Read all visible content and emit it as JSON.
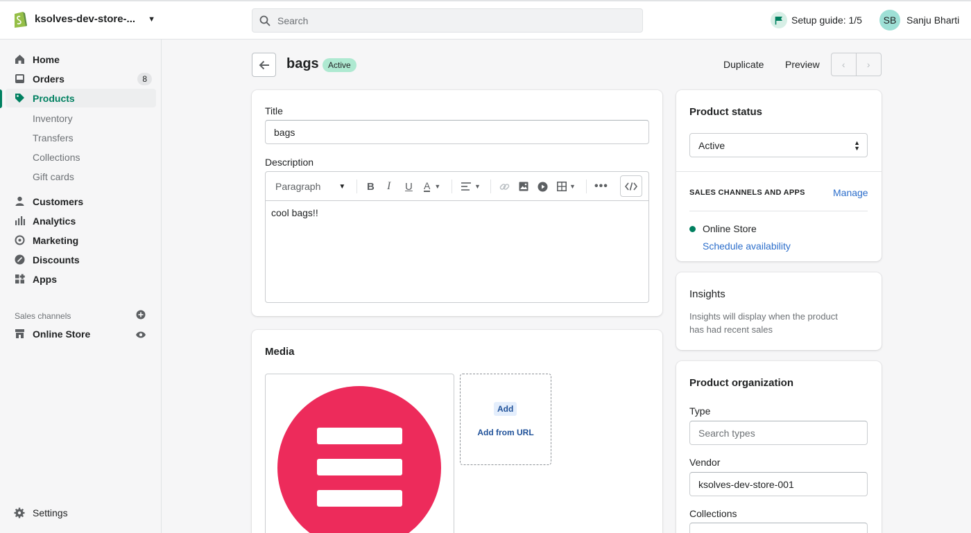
{
  "topbar": {
    "store_name": "ksolves-dev-store-...",
    "search_placeholder": "Search",
    "setup_guide": "Setup guide: 1/5",
    "user_initials": "SB",
    "user_name": "Sanju Bharti"
  },
  "sidebar": {
    "items": [
      {
        "label": "Home",
        "icon": "home-icon"
      },
      {
        "label": "Orders",
        "icon": "orders-icon",
        "count": "8"
      },
      {
        "label": "Products",
        "icon": "tag-icon",
        "active": true
      },
      {
        "label": "Customers",
        "icon": "person-icon"
      },
      {
        "label": "Analytics",
        "icon": "bar-chart-icon"
      },
      {
        "label": "Marketing",
        "icon": "marketing-icon"
      },
      {
        "label": "Discounts",
        "icon": "discount-icon"
      },
      {
        "label": "Apps",
        "icon": "apps-icon"
      }
    ],
    "subitems": [
      "Inventory",
      "Transfers",
      "Collections",
      "Gift cards"
    ],
    "sales_channels_label": "Sales channels",
    "online_store": "Online Store",
    "settings": "Settings"
  },
  "header": {
    "title": "bags",
    "status": "Active",
    "duplicate": "Duplicate",
    "preview": "Preview"
  },
  "product": {
    "title_label": "Title",
    "title_value": "bags",
    "description_label": "Description",
    "paragraph_select": "Paragraph",
    "description_text": "cool bags!!"
  },
  "media": {
    "title": "Media",
    "add_label": "Add",
    "add_from_url": "Add from URL"
  },
  "status_card": {
    "title": "Product status",
    "selected": "Active",
    "channels_heading": "SALES CHANNELS AND APPS",
    "manage": "Manage",
    "channel_name": "Online Store",
    "schedule": "Schedule availability"
  },
  "insights": {
    "title": "Insights",
    "text_line1": "Insights will display when the product",
    "text_line2": "has had recent sales"
  },
  "organization": {
    "title": "Product organization",
    "type_label": "Type",
    "type_placeholder": "Search types",
    "vendor_label": "Vendor",
    "vendor_value": "ksolves-dev-store-001",
    "collections_label": "Collections"
  },
  "colors": {
    "accent_green": "#008060",
    "link_blue": "#2c6ecb",
    "media_red": "#ed2b5b"
  }
}
